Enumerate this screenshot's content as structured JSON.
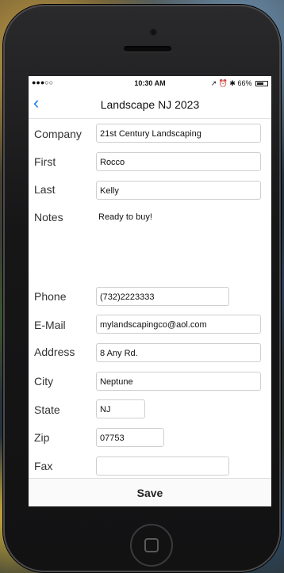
{
  "status": {
    "carrier": "●●●○○",
    "time": "10:30 AM",
    "right": "↗ ⏰ ✱ 66%",
    "battery_level": 0.66
  },
  "nav": {
    "back_icon": "‹",
    "title": "Landscape NJ 2023"
  },
  "form": {
    "company": {
      "label": "Company",
      "value": "21st Century Landscaping"
    },
    "first": {
      "label": "First",
      "value": "Rocco"
    },
    "last": {
      "label": "Last",
      "value": "Kelly"
    },
    "notes": {
      "label": "Notes",
      "value": "Ready to buy!"
    },
    "phone": {
      "label": "Phone",
      "value": "(732)2223333"
    },
    "email": {
      "label": "E-Mail",
      "value": "mylandscapingco@aol.com"
    },
    "address": {
      "label": "Address",
      "value": "8 Any Rd."
    },
    "city": {
      "label": "City",
      "value": "Neptune"
    },
    "state": {
      "label": "State",
      "value": "NJ"
    },
    "zip": {
      "label": "Zip",
      "value": "07753"
    },
    "fax": {
      "label": "Fax",
      "value": ""
    }
  },
  "save_label": "Save"
}
